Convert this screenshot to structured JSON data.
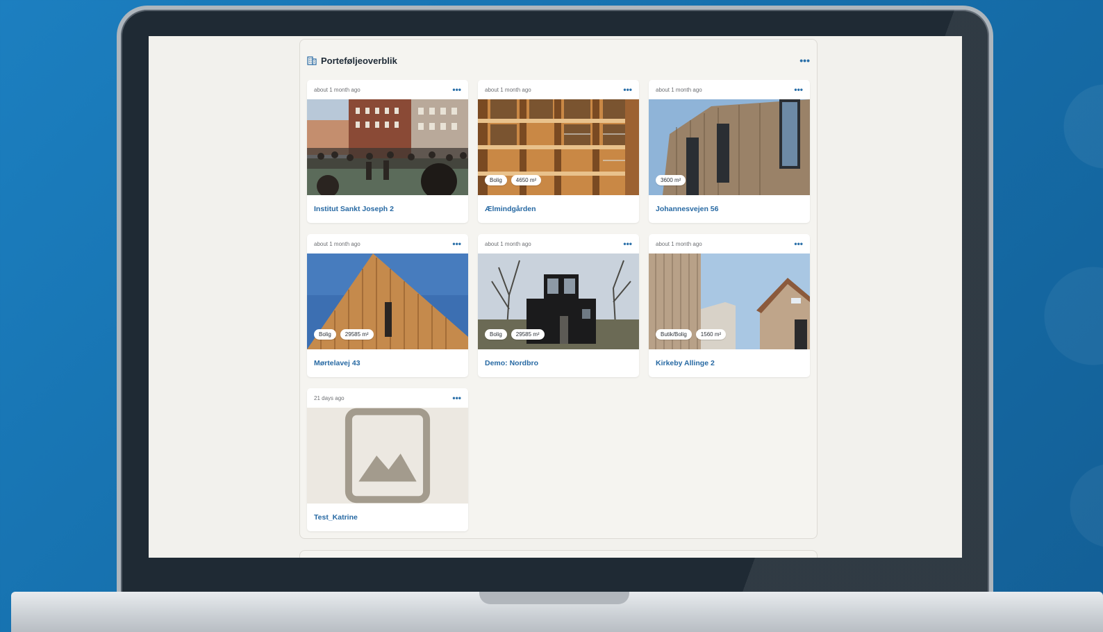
{
  "panel": {
    "title": "Porteføljeoverblik",
    "menu_icon": "more-horizontal-icon",
    "title_icon": "building-icon"
  },
  "properties": [
    {
      "date": "about 1 month ago",
      "name": "Institut Sankt Joseph 2",
      "tags": [],
      "image": "schoolyard-crowd-photo"
    },
    {
      "date": "about 1 month ago",
      "name": "Ælmindgården",
      "tags": [
        "Bolig",
        "4650 m²"
      ],
      "image": "wooden-balconies-photo"
    },
    {
      "date": "about 1 month ago",
      "name": "Johannesvejen 56",
      "tags": [
        "3600 m²"
      ],
      "image": "timber-facade-photo"
    },
    {
      "date": "about 1 month ago",
      "name": "Mørtelavej 43",
      "tags": [
        "Bolig",
        "29585 m²"
      ],
      "image": "timber-gable-photo"
    },
    {
      "date": "about 1 month ago",
      "name": "Demo: Nordbro",
      "tags": [
        "Bolig",
        "29585 m²"
      ],
      "image": "black-house-photo"
    },
    {
      "date": "about 1 month ago",
      "name": "Kirkeby Allinge 2",
      "tags": [
        "Butik/Bolig",
        "1560 m²"
      ],
      "image": "timber-houses-photo"
    },
    {
      "date": "21 days ago",
      "name": "Test_Katrine",
      "tags": [],
      "image": "image-placeholder-icon"
    }
  ],
  "colors": {
    "accent": "#2769a3",
    "background": "#1670ad",
    "screen": "#f2f1ed"
  }
}
